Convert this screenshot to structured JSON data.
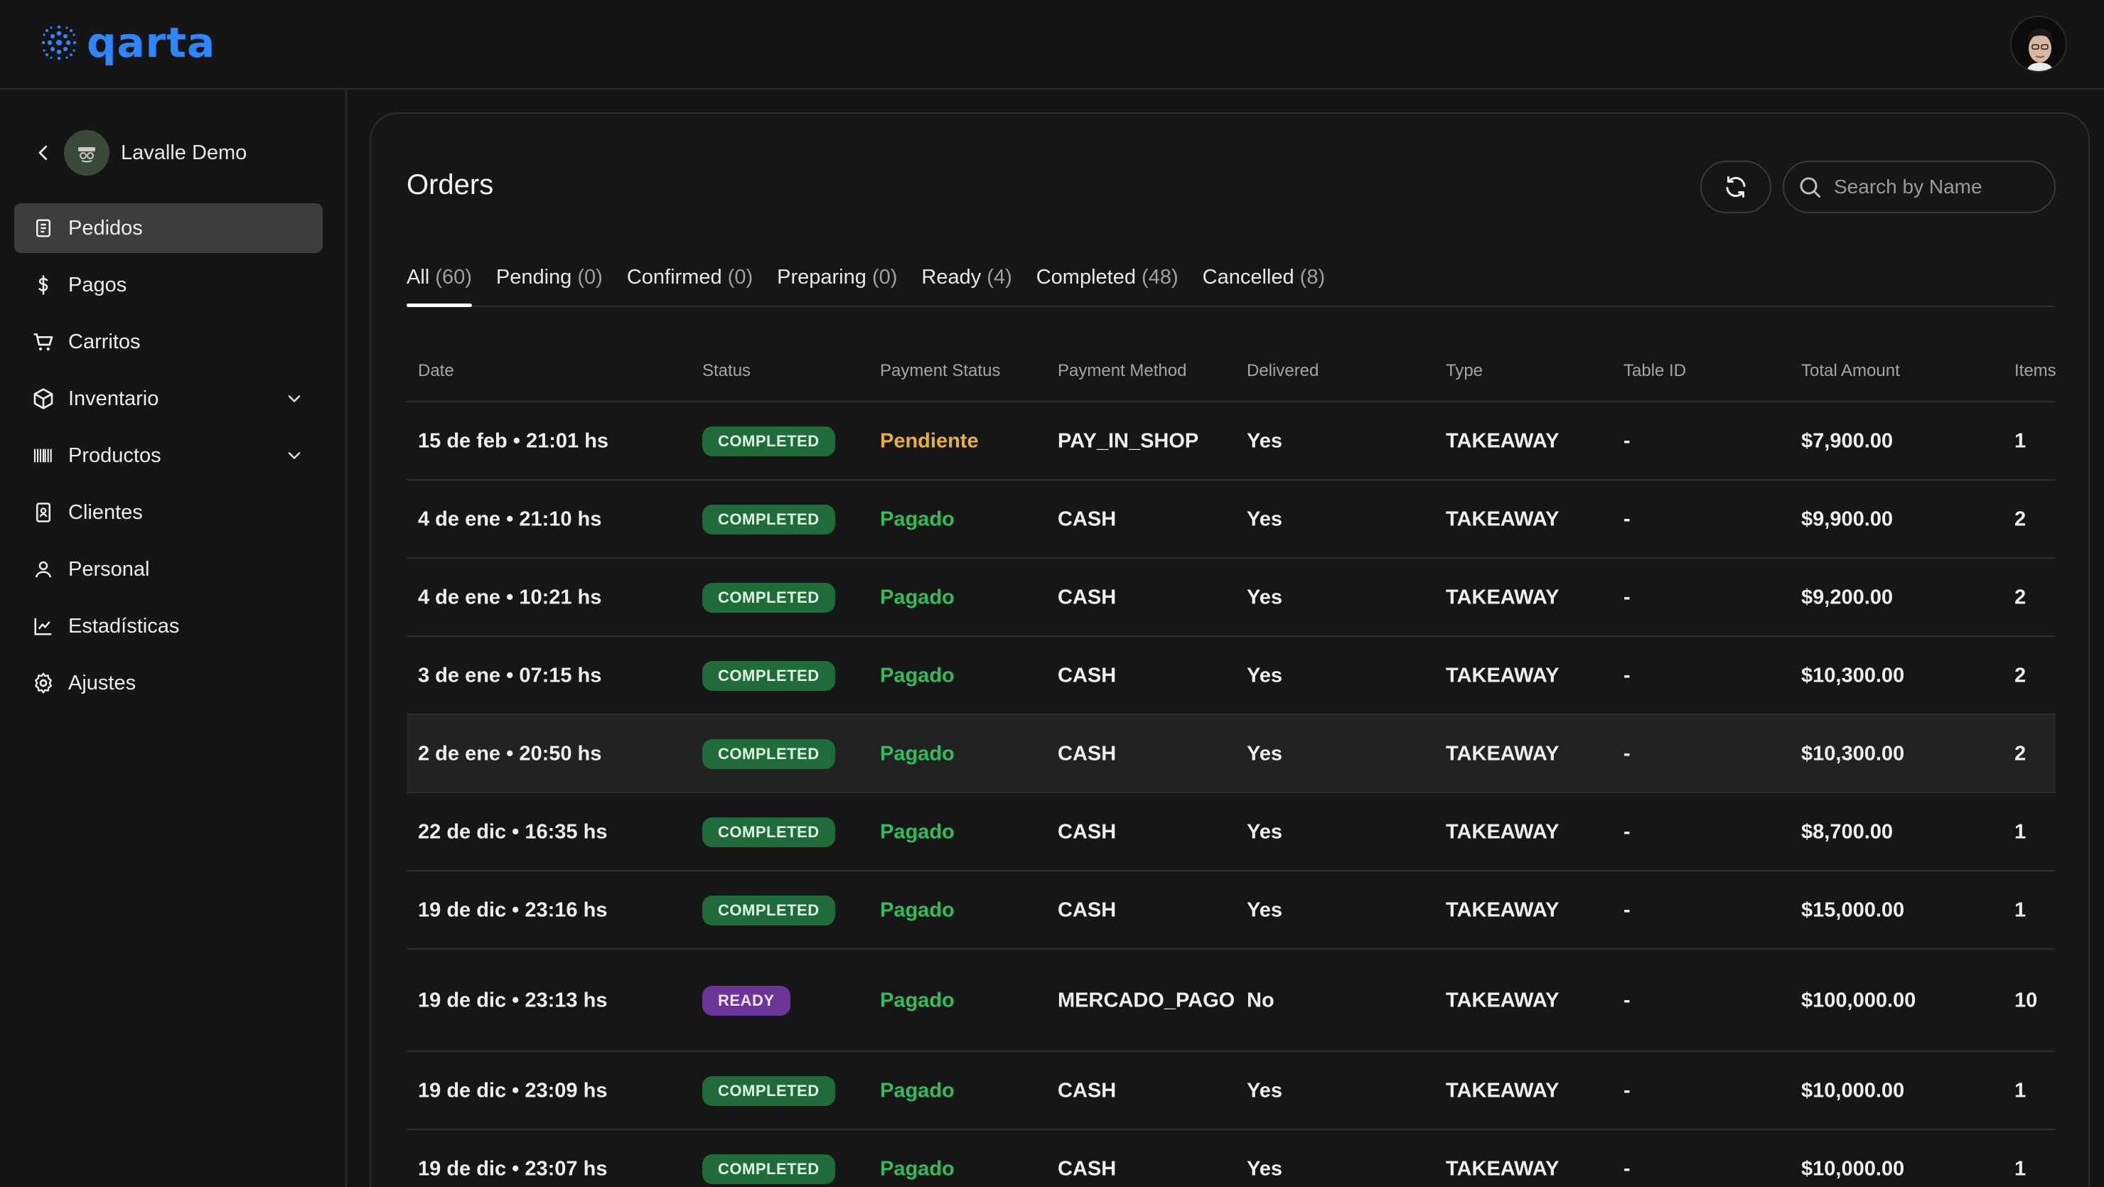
{
  "brand": {
    "name": "qarta",
    "color": "#2b86ff"
  },
  "user": {
    "avatar_icon": "user-avatar"
  },
  "sidebar": {
    "store_name": "Lavalle Demo",
    "items": [
      {
        "label": "Pedidos",
        "icon": "receipt-icon",
        "active": true
      },
      {
        "label": "Pagos",
        "icon": "dollar-icon"
      },
      {
        "label": "Carritos",
        "icon": "cart-icon"
      },
      {
        "label": "Inventario",
        "icon": "package-icon",
        "expandable": true
      },
      {
        "label": "Productos",
        "icon": "barcode-icon",
        "expandable": true
      },
      {
        "label": "Clientes",
        "icon": "contact-icon"
      },
      {
        "label": "Personal",
        "icon": "user-icon"
      },
      {
        "label": "Estadísticas",
        "icon": "chart-icon"
      },
      {
        "label": "Ajustes",
        "icon": "gear-icon"
      }
    ]
  },
  "main": {
    "title": "Orders",
    "search_placeholder": "Search by Name",
    "tabs": [
      {
        "label": "All",
        "count": "(60)",
        "active": true
      },
      {
        "label": "Pending",
        "count": "(0)"
      },
      {
        "label": "Confirmed",
        "count": "(0)"
      },
      {
        "label": "Preparing",
        "count": "(0)"
      },
      {
        "label": "Ready",
        "count": "(4)"
      },
      {
        "label": "Completed",
        "count": "(48)"
      },
      {
        "label": "Cancelled",
        "count": "(8)"
      }
    ],
    "columns": [
      "Date",
      "Status",
      "Payment Status",
      "Payment Method",
      "Delivered",
      "Type",
      "Table ID",
      "Total Amount",
      "Items"
    ],
    "rows": [
      {
        "date": "15 de feb • 21:01 hs",
        "status": "COMPLETED",
        "payment_status": "Pendiente",
        "method": "PAY_IN_SHOP",
        "delivered": "Yes",
        "type": "TAKEAWAY",
        "table": "-",
        "total": "$7,900.00",
        "items": "1"
      },
      {
        "date": "4 de ene • 21:10 hs",
        "status": "COMPLETED",
        "payment_status": "Pagado",
        "method": "CASH",
        "delivered": "Yes",
        "type": "TAKEAWAY",
        "table": "-",
        "total": "$9,900.00",
        "items": "2"
      },
      {
        "date": "4 de ene • 10:21 hs",
        "status": "COMPLETED",
        "payment_status": "Pagado",
        "method": "CASH",
        "delivered": "Yes",
        "type": "TAKEAWAY",
        "table": "-",
        "total": "$9,200.00",
        "items": "2"
      },
      {
        "date": "3 de ene • 07:15 hs",
        "status": "COMPLETED",
        "payment_status": "Pagado",
        "method": "CASH",
        "delivered": "Yes",
        "type": "TAKEAWAY",
        "table": "-",
        "total": "$10,300.00",
        "items": "2"
      },
      {
        "date": "2 de ene • 20:50 hs",
        "status": "COMPLETED",
        "payment_status": "Pagado",
        "method": "CASH",
        "delivered": "Yes",
        "type": "TAKEAWAY",
        "table": "-",
        "total": "$10,300.00",
        "items": "2",
        "hover": true
      },
      {
        "date": "22 de dic • 16:35 hs",
        "status": "COMPLETED",
        "payment_status": "Pagado",
        "method": "CASH",
        "delivered": "Yes",
        "type": "TAKEAWAY",
        "table": "-",
        "total": "$8,700.00",
        "items": "1"
      },
      {
        "date": "19 de dic • 23:16 hs",
        "status": "COMPLETED",
        "payment_status": "Pagado",
        "method": "CASH",
        "delivered": "Yes",
        "type": "TAKEAWAY",
        "table": "-",
        "total": "$15,000.00",
        "items": "1"
      },
      {
        "date": "19 de dic • 23:13 hs",
        "status": "READY",
        "payment_status": "Pagado",
        "method": "MERCADO_PAGO",
        "delivered": "No",
        "type": "TAKEAWAY",
        "table": "-",
        "total": "$100,000.00",
        "items": "10"
      },
      {
        "date": "19 de dic • 23:09 hs",
        "status": "COMPLETED",
        "payment_status": "Pagado",
        "method": "CASH",
        "delivered": "Yes",
        "type": "TAKEAWAY",
        "table": "-",
        "total": "$10,000.00",
        "items": "1"
      },
      {
        "date": "19 de dic • 23:07 hs",
        "status": "COMPLETED",
        "payment_status": "Pagado",
        "method": "CASH",
        "delivered": "Yes",
        "type": "TAKEAWAY",
        "table": "-",
        "total": "$10,000.00",
        "items": "1"
      }
    ]
  }
}
